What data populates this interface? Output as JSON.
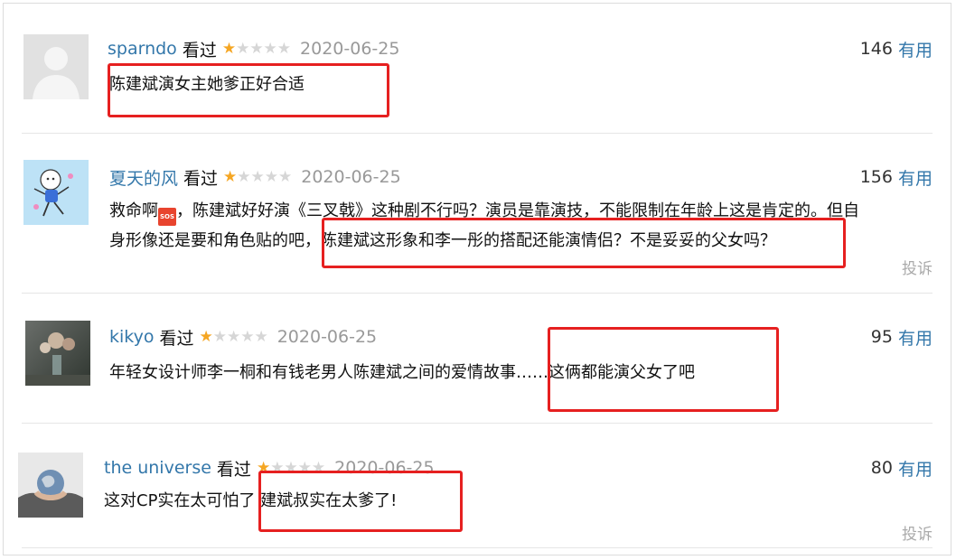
{
  "vote_suffix": "有用",
  "watched_label": "看过",
  "report_label": "投诉",
  "sos_emoji_text": "SOS",
  "accent_color": "#3377aa",
  "highlight_color": "#e62020",
  "comments": [
    {
      "user": "sparndo",
      "rating": 1,
      "date": "2020-06-25",
      "votes": "146",
      "avatar": "default-user-avatar",
      "text_lines": [
        "陈建斌演女主她爹正好合适"
      ]
    },
    {
      "user": "夏天的风",
      "rating": 1,
      "date": "2020-06-25",
      "votes": "156",
      "avatar": "cartoon-avatar",
      "text_prefix": "救命啊",
      "text_line1_rest": "，陈建斌好好演《三叉戟》这种剧不行吗？演员是靠演技，不能限制在年龄上这是肯定的。但自",
      "text_line2": "身形像还是要和角色贴的吧，陈建斌这形象和李一彤的搭配还能演情侣？不是妥妥的父女吗？",
      "report": true
    },
    {
      "user": "kikyo",
      "rating": 1,
      "date": "2020-06-25",
      "votes": "95",
      "avatar": "flowers-photo-avatar",
      "text_lines": [
        "年轻女设计师李一桐和有钱老男人陈建斌之间的爱情故事……这俩都能演父女了吧"
      ]
    },
    {
      "user": "the universe",
      "rating": 1,
      "date": "2020-06-25",
      "votes": "80",
      "avatar": "hands-globe-avatar",
      "text_lines": [
        "这对CP实在太可怕了 建斌叔实在太爹了!"
      ],
      "report": true
    }
  ]
}
